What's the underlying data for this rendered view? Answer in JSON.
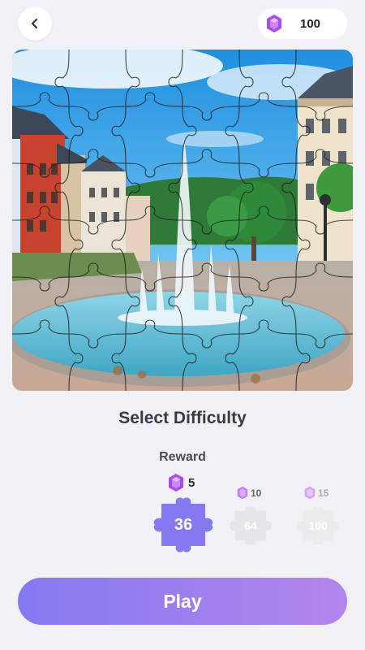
{
  "header": {
    "back_icon": "chevron-left-icon",
    "gem_icon": "purple-gem-icon",
    "gem_count": "100"
  },
  "puzzle": {
    "image_subject": "town square fountain photo with puzzle grid overlay",
    "grid_pieces": 36
  },
  "title": "Select Difficulty",
  "reward_label": "Reward",
  "options": [
    {
      "reward": "5",
      "pieces": "36",
      "selected": true
    },
    {
      "reward": "10",
      "pieces": "64",
      "selected": false
    },
    {
      "reward": "15",
      "pieces": "100",
      "selected": false
    }
  ],
  "play_label": "Play",
  "colors": {
    "background": "#f2f2f6",
    "accent": "#8579f0",
    "accent_end": "#b386ec",
    "gem": "#a64df2",
    "disabled_piece": "#e6e6ea"
  }
}
